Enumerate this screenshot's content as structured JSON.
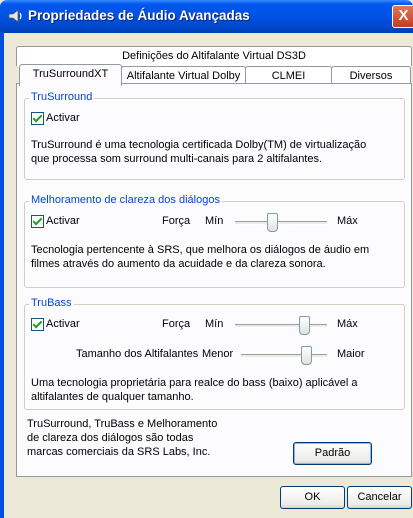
{
  "window": {
    "title": "Propriedades de Áudio Avançadas",
    "close_glyph": "X"
  },
  "tabs": {
    "row1": [
      "Definições do Altifalante Virtual DS3D"
    ],
    "row2": [
      "TruSurroundXT",
      "Altifalante Virtual Dolby",
      "CLMEI",
      "Diversos"
    ],
    "active": "TruSurroundXT"
  },
  "trusurround": {
    "title": "TruSurround",
    "checkbox_label": "Activar",
    "checked": true,
    "description": "TruSurround é uma tecnologia certificada Dolby(TM) de virtualização que processa som surround multi-canais para 2 altifalantes."
  },
  "dialog_clarity": {
    "title": "Melhoramento de clareza dos diálogos",
    "checkbox_label": "Activar",
    "checked": true,
    "force_label": "Força",
    "min_label": "Mín",
    "max_label": "Máx",
    "force_level": 0.4,
    "description": "Tecnologia pertencente à SRS, que melhora os diálogos de áudio em filmes através do aumento da acuidade e da clareza sonora."
  },
  "trubass": {
    "title": "TruBass",
    "checkbox_label": "Activar",
    "checked": true,
    "force_label": "Força",
    "min_label": "Mín",
    "max_label": "Máx",
    "force_level": 0.75,
    "speaker_size_label": "Tamanho dos Altifalantes",
    "smaller_label": "Menor",
    "larger_label": "Maior",
    "speaker_size_level": 0.75,
    "description": "Uma tecnologia proprietária para realce do bass (baixo) aplicável a altifalantes de qualquer tamanho."
  },
  "footer": {
    "trademark_note": "TruSurround, TruBass e Melhoramento de clareza dos diálogos são todas marcas comerciais da SRS Labs, Inc.",
    "default_button": "Padrão"
  },
  "buttons": {
    "ok": "OK",
    "cancel": "Cancelar"
  },
  "colors": {
    "titlebar": "#0050E0",
    "group_title": "#0046D5",
    "window_bg": "#ECE9D8",
    "panel_bg": "#FCFCFE"
  },
  "icons": {
    "title_icon": "speaker-icon",
    "close": "close-icon"
  }
}
